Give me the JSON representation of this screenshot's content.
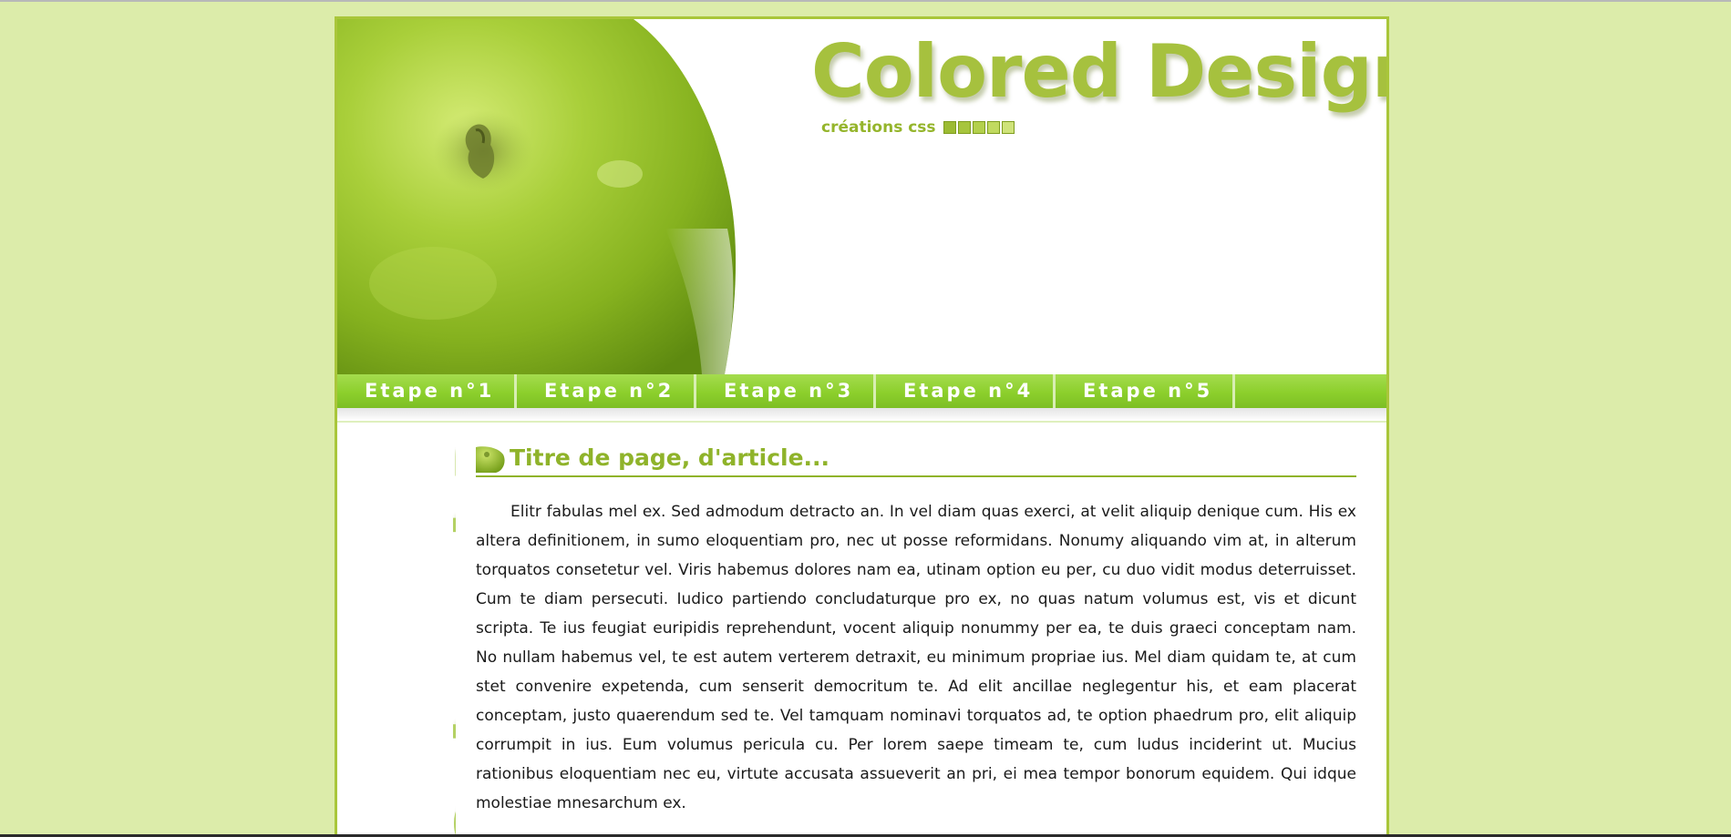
{
  "site": {
    "title": "Colored Design",
    "subtitle": "créations css",
    "square_colors": [
      "#9cbb33",
      "#a7c53d",
      "#b3d04c",
      "#c1da60",
      "#cfe37a"
    ],
    "side_text": "Colored Design"
  },
  "nav": {
    "items": [
      {
        "label": "Etape n°1"
      },
      {
        "label": "Etape n°2"
      },
      {
        "label": "Etape n°3"
      },
      {
        "label": "Etape n°4"
      },
      {
        "label": "Etape n°5"
      }
    ]
  },
  "article": {
    "title": "Titre de page, d'article...",
    "body": "Elitr fabulas mel ex. Sed admodum detracto an. In vel diam quas exerci, at velit aliquip denique cum. His ex altera definitionem, in sumo eloquentiam pro, nec ut posse reformidans. Nonumy aliquando vim at, in alterum torquatos consetetur vel. Viris habemus dolores nam ea, utinam option eu per, cu duo vidit modus deterruisset. Cum te diam persecuti. Iudico partiendo concludaturque pro ex, no quas natum volumus est, vis et dicunt scripta. Te ius feugiat euripidis reprehendunt, vocent aliquip nonummy per ea, te duis graeci conceptam nam. No nullam habemus vel, te est autem verterem detraxit, eu minimum propriae ius. Mel diam quidam te, at cum stet convenire expetenda, cum senserit democritum te. Ad elit ancillae neglegentur his, et eam placerat conceptam, justo quaerendum sed te. Vel tamquam nominavi torquatos ad, te option phaedrum pro, elit aliquip corrumpit in ius. Eum volumus pericula cu. Per lorem saepe timeam te, cum ludus inciderint ut. Mucius rationibus eloquentiam nec eu, virtute accusata assueverit an pri, ei mea tempor bonorum equidem. Qui idque molestiae mnesarchum ex."
  },
  "colors": {
    "background": "#dcecaa",
    "border": "#a9c63a",
    "accent": "#8fb32a",
    "nav": "#8ccf2c"
  }
}
